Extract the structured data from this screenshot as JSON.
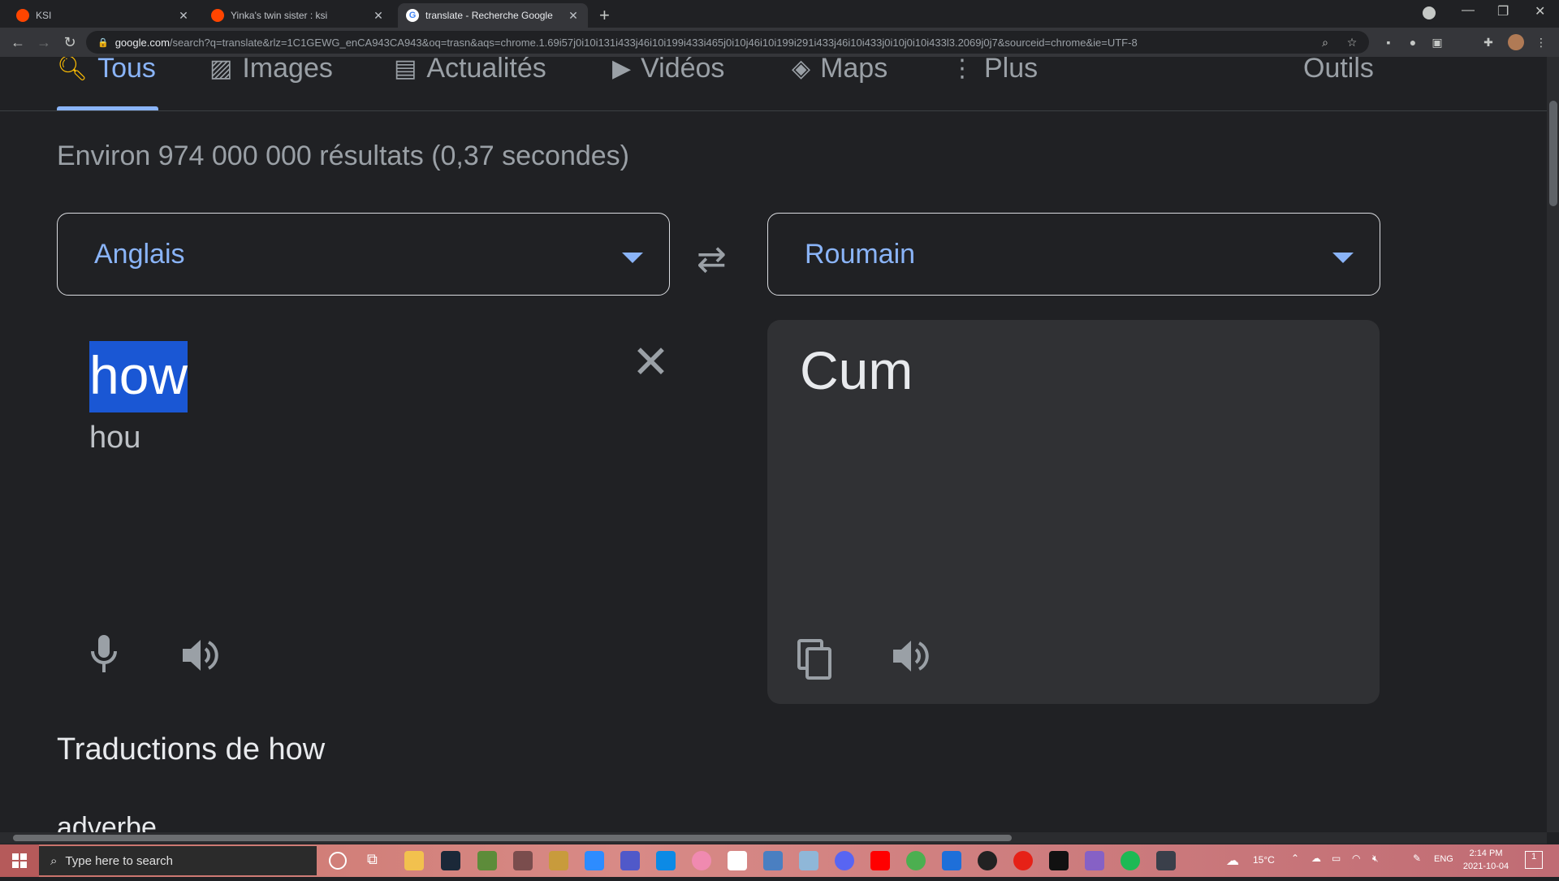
{
  "browser": {
    "tabs": [
      {
        "title": "KSI",
        "active": false
      },
      {
        "title": "Yinka's twin sister : ksi",
        "active": false
      },
      {
        "title": "translate - Recherche Google",
        "active": true
      }
    ],
    "new_tab": "+",
    "address_host": "google.com",
    "address_rest": "/search?q=translate&rlz=1C1GEWG_enCA943CA943&oq=trasn&aqs=chrome.1.69i57j0i10i131i433j46i10i199i433i465j0i10j46i10i199i291i433j46i10i433j0i10j0i10i433l3.2069j0j7&sourceid=chrome&ie=UTF-8"
  },
  "search_nav": {
    "tabs": [
      "Tous",
      "Images",
      "Actualités",
      "Vidéos",
      "Maps",
      "Plus"
    ],
    "tools": "Outils"
  },
  "result_stats": "Environ 974 000 000 résultats (0,37 secondes)",
  "translate": {
    "source_lang": "Anglais",
    "target_lang": "Roumain",
    "source_text": "how",
    "source_transliteration": "hou",
    "target_text": "Cum"
  },
  "translations_heading": "Traductions de how",
  "partial_text": "adverbe",
  "taskbar": {
    "search_placeholder": "Type here to search",
    "temperature": "15°C",
    "language": "ENG",
    "time": "2:14 PM",
    "date": "2021-10-04",
    "notifications": "1"
  },
  "colors": {
    "accent": "#8ab4f8",
    "selection": "#1a57d4",
    "background": "#202124"
  }
}
